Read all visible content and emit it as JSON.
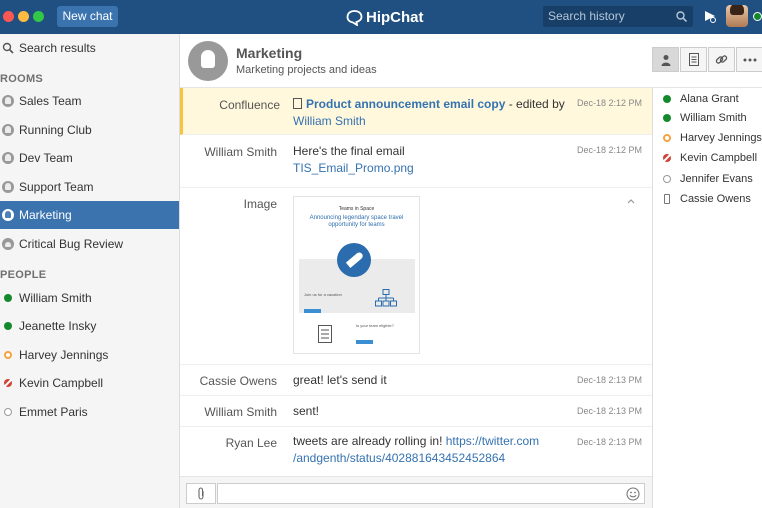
{
  "titlebar": {
    "new_chat": "New chat",
    "brand": "HipChat",
    "search_placeholder": "Search history"
  },
  "sidebar": {
    "search_results": "Search results",
    "rooms_header": "ROOMS",
    "rooms": [
      {
        "label": "Sales Team",
        "icon": "room-icon"
      },
      {
        "label": "Running Club",
        "icon": "room-icon"
      },
      {
        "label": "Dev Team",
        "icon": "room-icon"
      },
      {
        "label": "Support Team",
        "icon": "room-icon"
      },
      {
        "label": "Marketing",
        "icon": "room-icon",
        "active": true
      },
      {
        "label": "Critical Bug Review",
        "icon": "lock-room-icon"
      }
    ],
    "people_header": "PEOPLE",
    "people": [
      {
        "label": "William Smith",
        "status": "available"
      },
      {
        "label": "Jeanette Insky",
        "status": "available"
      },
      {
        "label": "Harvey Jennings",
        "status": "away"
      },
      {
        "label": "Kevin Campbell",
        "status": "do-not-disturb"
      },
      {
        "label": "Emmet Paris",
        "status": "offline"
      }
    ]
  },
  "room": {
    "title": "Marketing",
    "topic": "Marketing projects and ideas"
  },
  "messages": [
    {
      "sender": "Confluence",
      "time": "Dec-18 2:12 PM",
      "link": "Product announcement email copy",
      "text": " - edited by ",
      "author": "William Smith"
    },
    {
      "sender": "William Smith",
      "time": "Dec-18 2:12 PM",
      "text": "Here's the final email",
      "file": "TIS_Email_Promo.png"
    },
    {
      "sender": "Image",
      "thumb": {
        "title": "Teams in Space",
        "headline": "Announcing legendary space travel opportunity for teams",
        "join": "Join us for a vacation",
        "eligible": "Is your team eligible?"
      }
    },
    {
      "sender": "Cassie Owens",
      "time": "Dec-18 2:13 PM",
      "text": "great! let's send it"
    },
    {
      "sender": "William Smith",
      "time": "Dec-18 2:13 PM",
      "text": "sent!"
    },
    {
      "sender": "Ryan Lee",
      "time": "Dec-18 2:13 PM",
      "text": "tweets are already rolling in! ",
      "url_line1": "https://twitter.com",
      "url_line2": "/andgenth/status/402881643452452864"
    }
  ],
  "roster": [
    {
      "name": "Alana Grant",
      "status": "available"
    },
    {
      "name": "William Smith",
      "status": "available"
    },
    {
      "name": "Harvey Jennings",
      "status": "away"
    },
    {
      "name": "Kevin Campbell",
      "status": "do-not-disturb"
    },
    {
      "name": "Jennifer Evans",
      "status": "offline"
    },
    {
      "name": "Cassie Owens",
      "status": "mobile"
    }
  ],
  "colors": {
    "titlebar": "#205081",
    "accent": "#3b73af",
    "link": "#3572b0",
    "available": "#14892c",
    "away": "#f6a340",
    "dnd": "#d04437"
  }
}
